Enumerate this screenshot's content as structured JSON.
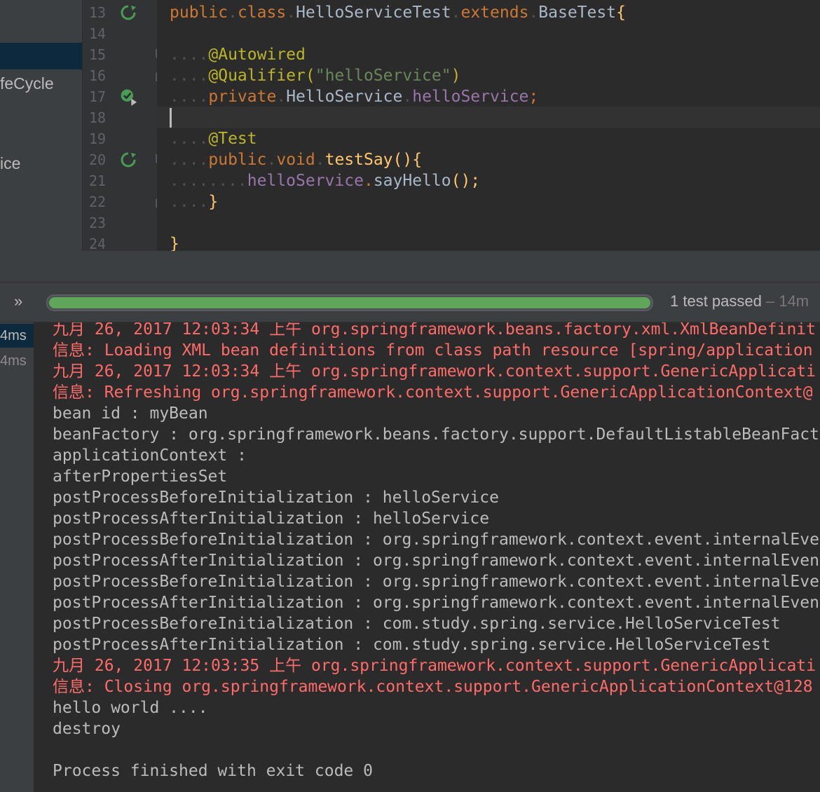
{
  "sidebar": {
    "items": [
      {
        "label": "feCycle"
      },
      {
        "label": "ice"
      }
    ]
  },
  "editor": {
    "line_numbers": [
      "13",
      "14",
      "15",
      "16",
      "17",
      "18",
      "19",
      "20",
      "21",
      "22",
      "23",
      "24"
    ],
    "lines": {
      "l13": {
        "kw1": "public",
        "kw2": "class",
        "cls": "HelloServiceTest",
        "kw3": "extends",
        "base": "BaseTest",
        "brace": "{"
      },
      "l15": {
        "ann": "@Autowired"
      },
      "l16": {
        "ann": "@Qualifier(",
        "str": "\"helloService\"",
        "close": ")"
      },
      "l17": {
        "kw": "private",
        "type": "HelloService",
        "field": "helloService",
        "semi": ";"
      },
      "l19": {
        "ann": "@Test"
      },
      "l20": {
        "kw1": "public",
        "kw2": "void",
        "fn": "testSay",
        "rest": "(){"
      },
      "l21": {
        "field": "helloService",
        "dot": ".",
        "fn": "sayHello",
        "rest": "();"
      },
      "l22": {
        "brace": "}"
      },
      "l24": {
        "brace": "}"
      }
    }
  },
  "runbar": {
    "chevron": "»",
    "progress_fraction": 1.0,
    "status": "1 test passed",
    "duration": " – 14m"
  },
  "test_tree": {
    "items": [
      {
        "label": "4ms"
      },
      {
        "label": "4ms"
      }
    ]
  },
  "console": {
    "lines": [
      {
        "text": "九月 26, 2017 12:03:34 上午 org.springframework.beans.factory.xml.XmlBeanDefinit",
        "err": true
      },
      {
        "text": "信息: Loading XML bean definitions from class path resource [spring/application",
        "err": true
      },
      {
        "text": "九月 26, 2017 12:03:34 上午 org.springframework.context.support.GenericApplicati",
        "err": true
      },
      {
        "text": "信息: Refreshing org.springframework.context.support.GenericApplicationContext@",
        "err": true
      },
      {
        "text": "bean id : myBean",
        "err": false
      },
      {
        "text": "beanFactory : org.springframework.beans.factory.support.DefaultListableBeanFact",
        "err": false
      },
      {
        "text": "applicationContext : ",
        "err": false
      },
      {
        "text": "afterPropertiesSet",
        "err": false
      },
      {
        "text": "postProcessBeforeInitialization : helloService",
        "err": false
      },
      {
        "text": "postProcessAfterInitialization : helloService",
        "err": false
      },
      {
        "text": "postProcessBeforeInitialization : org.springframework.context.event.internalEve",
        "err": false
      },
      {
        "text": "postProcessAfterInitialization : org.springframework.context.event.internalEven",
        "err": false
      },
      {
        "text": "postProcessBeforeInitialization : org.springframework.context.event.internalEve",
        "err": false
      },
      {
        "text": "postProcessAfterInitialization : org.springframework.context.event.internalEven",
        "err": false
      },
      {
        "text": "postProcessBeforeInitialization : com.study.spring.service.HelloServiceTest",
        "err": false
      },
      {
        "text": "postProcessAfterInitialization : com.study.spring.service.HelloServiceTest",
        "err": false
      },
      {
        "text": "九月 26, 2017 12:03:35 上午 org.springframework.context.support.GenericApplicati",
        "err": true
      },
      {
        "text": "信息: Closing org.springframework.context.support.GenericApplicationContext@128",
        "err": true
      },
      {
        "text": "hello world ....",
        "err": false
      },
      {
        "text": "destroy",
        "err": false
      },
      {
        "text": "",
        "err": false
      },
      {
        "text": "Process finished with exit code 0",
        "err": false
      }
    ]
  },
  "colors": {
    "error_text": "#ff6b68",
    "pass_green": "#5fa55a",
    "keyword": "#cc7832",
    "annotation": "#bbb529",
    "string": "#6a8759",
    "field": "#9876aa",
    "method": "#ffc66d"
  },
  "icons": {
    "run": "run-icon",
    "debug_run": "debug-run-icon",
    "fold": "fold-icon"
  }
}
